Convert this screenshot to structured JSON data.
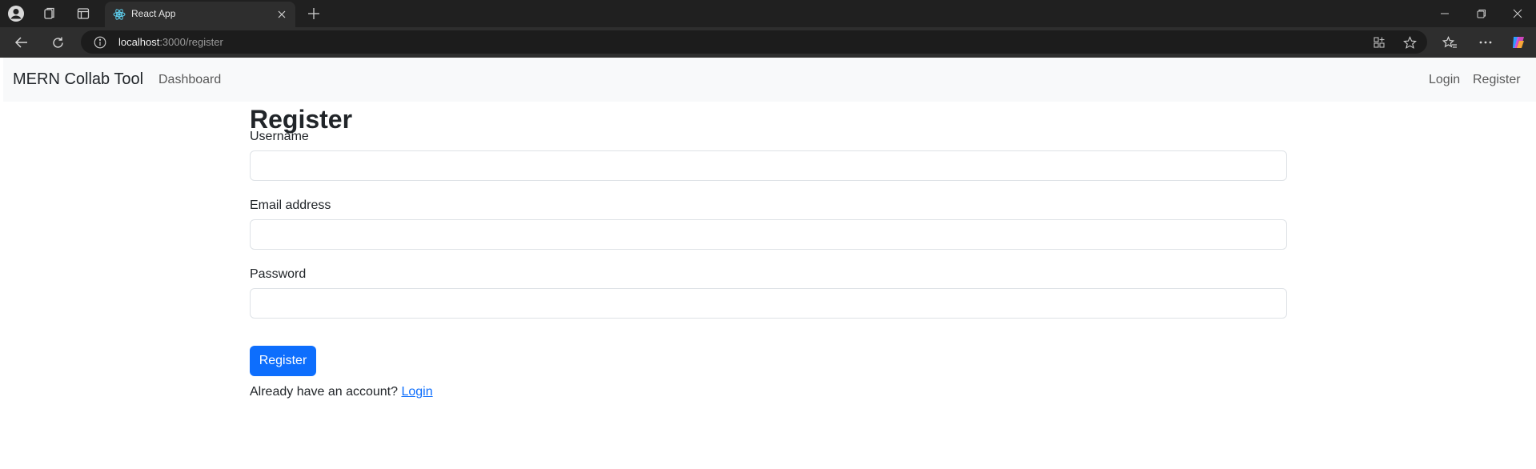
{
  "browser": {
    "tab_title": "React App",
    "url_host": "localhost",
    "url_path": ":3000/register"
  },
  "navbar": {
    "brand": "MERN Collab Tool",
    "links": [
      "Dashboard"
    ],
    "right_links": [
      "Login",
      "Register"
    ]
  },
  "page": {
    "title": "Register",
    "fields": [
      {
        "label": "Username",
        "value": "",
        "placeholder": ""
      },
      {
        "label": "Email address",
        "value": "",
        "placeholder": ""
      },
      {
        "label": "Password",
        "value": "",
        "placeholder": ""
      }
    ],
    "submit_label": "Register",
    "footer_text": "Already have an account? ",
    "footer_link": "Login"
  },
  "colors": {
    "primary": "#0d6efd",
    "navbar_bg": "#f8f9fa",
    "chrome_bg": "#202020"
  },
  "icons": [
    "profile-icon",
    "workspaces-icon",
    "vertical-tabs-icon",
    "react-favicon-icon",
    "close-icon",
    "new-tab-icon",
    "minimize-icon",
    "restore-icon",
    "window-close-icon",
    "back-icon",
    "refresh-icon",
    "info-icon",
    "app-available-icon",
    "favorite-icon",
    "favorites-icon",
    "more-icon",
    "copilot-icon"
  ]
}
